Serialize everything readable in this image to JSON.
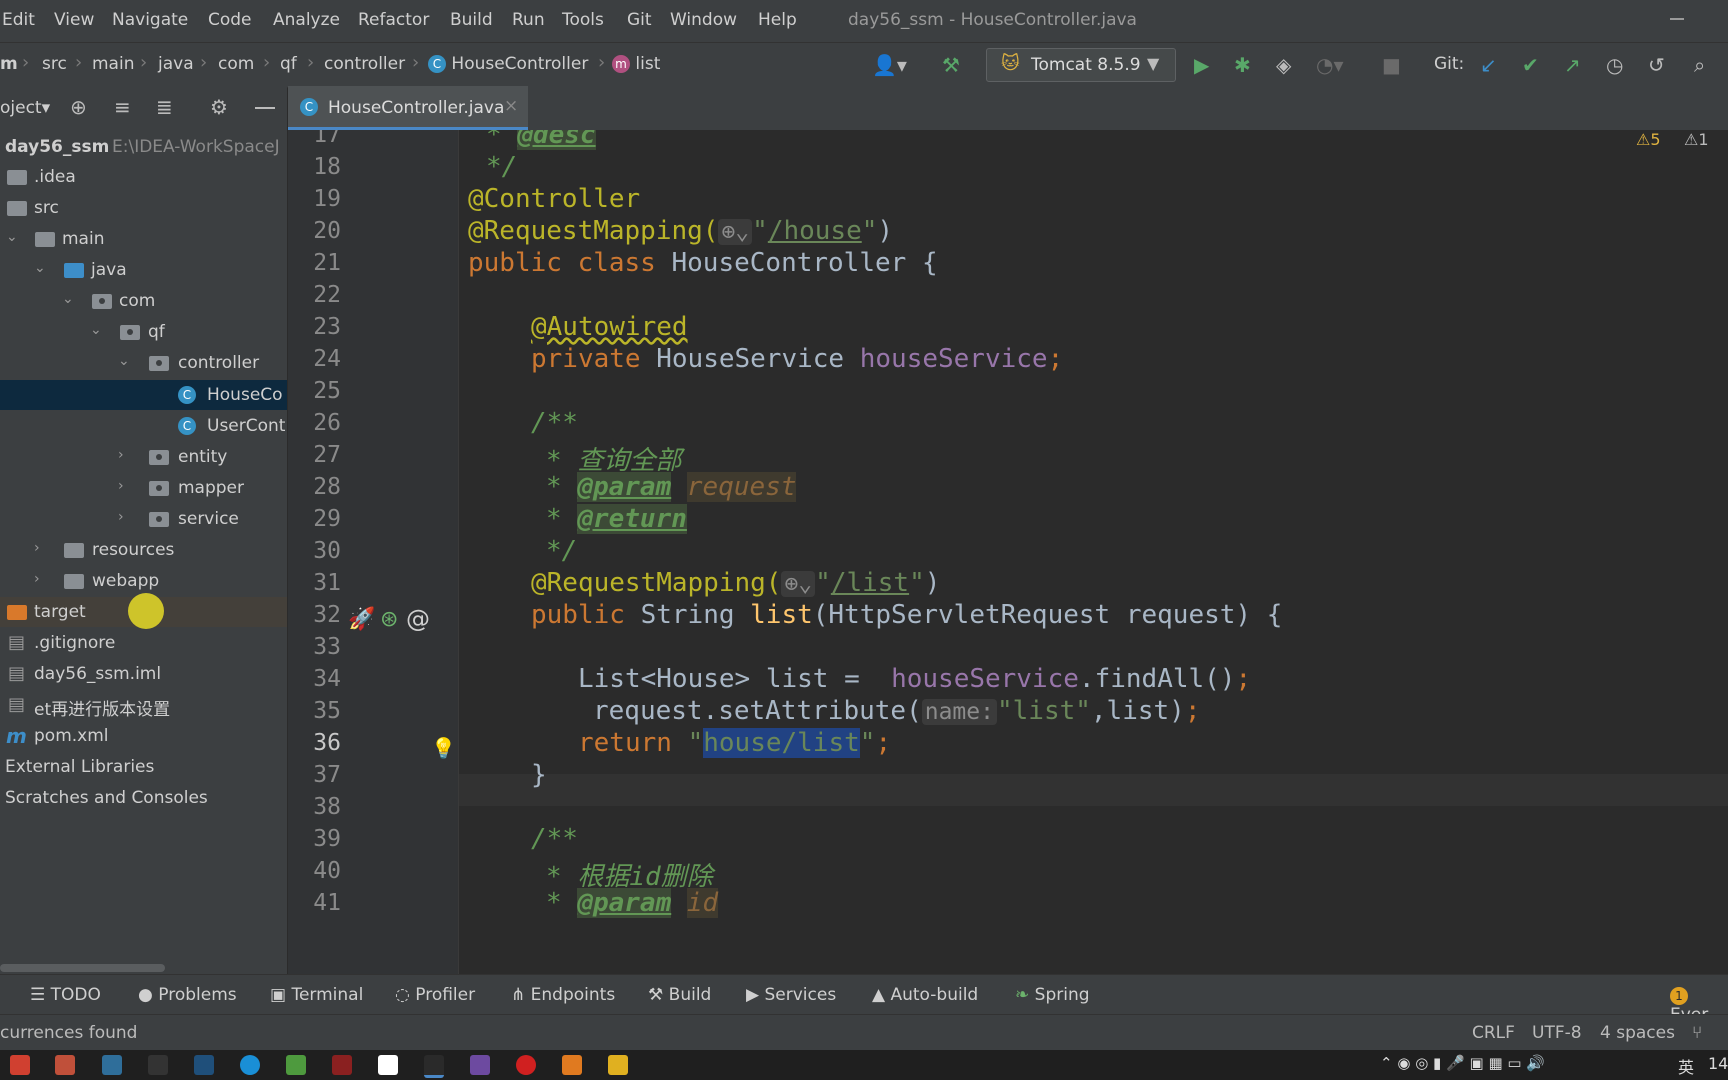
{
  "menu": {
    "items": [
      "Edit",
      "View",
      "Navigate",
      "Code",
      "Analyze",
      "Refactor",
      "Build",
      "Run",
      "Tools",
      "Git",
      "Window",
      "Help"
    ],
    "window_title": "day56_ssm - HouseController.java"
  },
  "breadcrumb": {
    "items": [
      "m",
      "src",
      "main",
      "java",
      "com",
      "qf",
      "controller",
      "HouseController",
      "list"
    ]
  },
  "run_config": {
    "label": "Tomcat 8.5.9"
  },
  "git": {
    "label": "Git:"
  },
  "project_header": {
    "label": "oject"
  },
  "project_tree": {
    "root": {
      "name": "day56_ssm",
      "path": "E:\\IDEA-WorkSpaceJ"
    },
    "items": [
      ".idea",
      "src",
      "main",
      "java",
      "com",
      "qf",
      "controller",
      "HouseCo",
      "UserCont",
      "entity",
      "mapper",
      "service",
      "resources",
      "webapp",
      "target",
      ".gitignore",
      "day56_ssm.iml",
      "et再进行版本设置",
      "pom.xml",
      "External Libraries",
      "Scratches and Consoles"
    ]
  },
  "editor_tab": {
    "label": "HouseController.java"
  },
  "inspections": {
    "warnings": "5",
    "weak_warnings": "1"
  },
  "code": {
    "line_numbers": [
      "17",
      "18",
      "19",
      "20",
      "21",
      "22",
      "23",
      "24",
      "25",
      "26",
      "27",
      "28",
      "29",
      "30",
      "31",
      "32",
      "33",
      "34",
      "35",
      "36",
      "37",
      "38",
      "39",
      "40",
      "41"
    ],
    "l17_star": "* ",
    "l17_tag": "@desc",
    "l18": "*/",
    "l19": "@Controller",
    "l20_ann": "@RequestMapping(",
    "l20_url": "/house",
    "l21_kw": "public class ",
    "l21_name": "HouseController {",
    "l23": "@Autowired",
    "l24_kw": "private ",
    "l24_type": "HouseService ",
    "l24_field": "houseService",
    "l26": "/**",
    "l27_star": "* ",
    "l27_text": "查询全部",
    "l28_star": "* ",
    "l28_tag": "@param",
    "l28_param": "request",
    "l29_star": "* ",
    "l29_tag": "@return",
    "l30": "*/",
    "l31_ann": "@RequestMapping(",
    "l31_url": "/list",
    "l32_kw": "public ",
    "l32_type": "String ",
    "l32_fn": "list",
    "l32_rest": "(HttpServletRequest request) {",
    "l34_a": "List<House> list =  ",
    "l34_field": "houseService",
    "l34_b": ".findAll()",
    "l35_a": "request.setAttribute(",
    "l35_hint": "name:",
    "l35_str": "\"list\"",
    "l35_b": ",list)",
    "l36_kw": "return ",
    "l36_sel": "house/list",
    "l37": "}",
    "l39": "/**",
    "l40_star": "* ",
    "l40_text": "根据id删除",
    "l41_star": "* ",
    "l41_tag": "@param",
    "l41_param": "id"
  },
  "bottom_tools": [
    "TODO",
    "Problems",
    "Terminal",
    "Profiler",
    "Endpoints",
    "Build",
    "Services",
    "Auto-build",
    "Spring",
    "Ever"
  ],
  "status": {
    "message": "currences found",
    "line_sep": "CRLF",
    "encoding": "UTF-8",
    "indent": "4 spaces",
    "event_count": "1"
  },
  "taskbar": {
    "ime": "英",
    "clock": "14"
  }
}
